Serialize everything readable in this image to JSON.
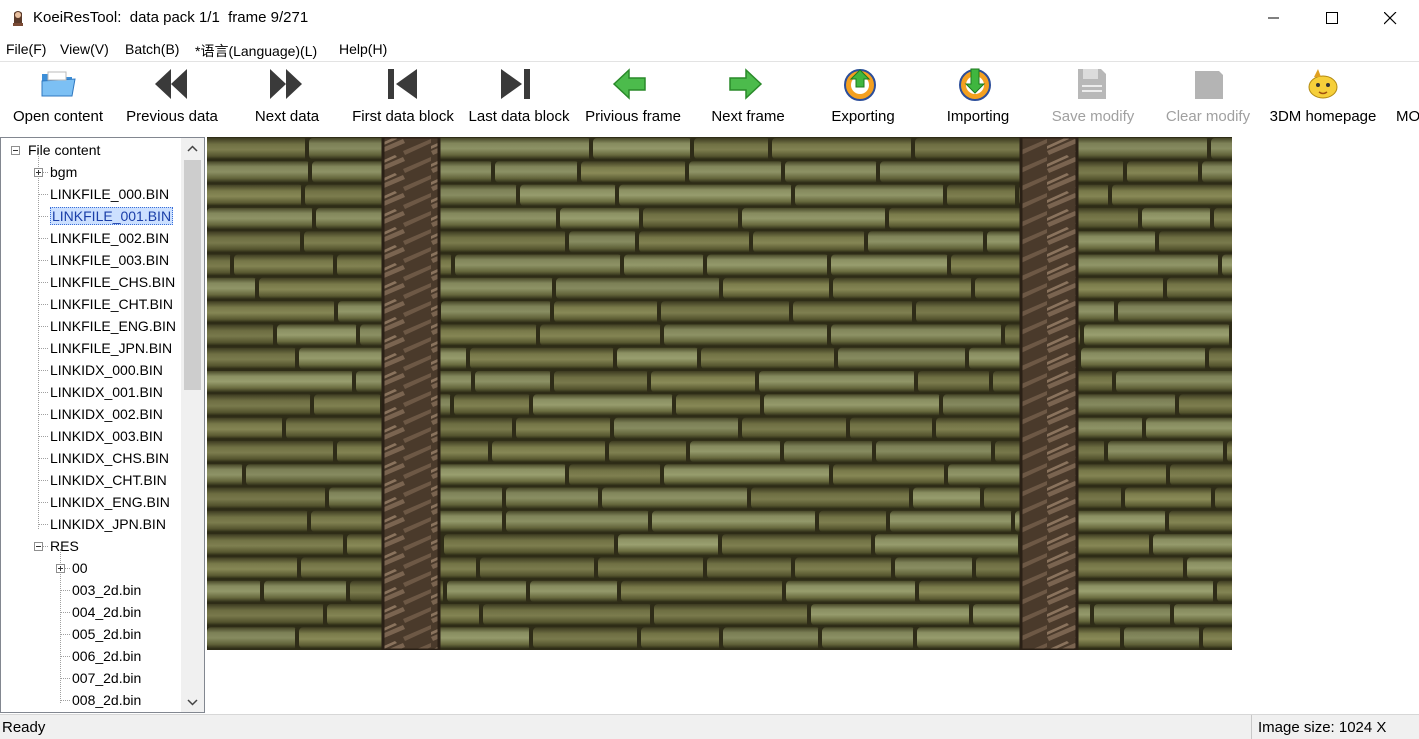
{
  "window": {
    "app_name": "KoeiResTool:",
    "title_info": "data pack 1/1  frame 9/271"
  },
  "menu": [
    "File(F)",
    "View(V)",
    "Batch(B)",
    "*语言(Language)(L)",
    "Help(H)"
  ],
  "toolbar": [
    {
      "label": "Open content",
      "icon": "open-folder-icon",
      "enabled": true
    },
    {
      "label": "Previous data",
      "icon": "double-left-arrow-icon",
      "enabled": true
    },
    {
      "label": "Next data",
      "icon": "double-right-arrow-icon",
      "enabled": true
    },
    {
      "label": "First data block",
      "icon": "skip-first-icon",
      "enabled": true
    },
    {
      "label": "Last data block",
      "icon": "skip-last-icon",
      "enabled": true
    },
    {
      "label": "Privious frame",
      "icon": "green-left-arrow-icon",
      "enabled": true
    },
    {
      "label": "Next frame",
      "icon": "green-right-arrow-icon",
      "enabled": true
    },
    {
      "label": "Exporting",
      "icon": "export-icon",
      "enabled": true
    },
    {
      "label": "Importing",
      "icon": "import-icon",
      "enabled": true
    },
    {
      "label": "Save modify",
      "icon": "save-icon",
      "enabled": false
    },
    {
      "label": "Clear modify",
      "icon": "clear-icon",
      "enabled": false
    },
    {
      "label": "3DM homepage",
      "icon": "homepage-mascot-icon",
      "enabled": true
    },
    {
      "label": "MO",
      "icon": "",
      "enabled": true
    }
  ],
  "tree": {
    "root": "File content",
    "items": [
      {
        "label": "bgm",
        "level": 1,
        "expander": "plus"
      },
      {
        "label": "LINKFILE_000.BIN",
        "level": 1
      },
      {
        "label": "LINKFILE_001.BIN",
        "level": 1,
        "selected": true
      },
      {
        "label": "LINKFILE_002.BIN",
        "level": 1
      },
      {
        "label": "LINKFILE_003.BIN",
        "level": 1
      },
      {
        "label": "LINKFILE_CHS.BIN",
        "level": 1
      },
      {
        "label": "LINKFILE_CHT.BIN",
        "level": 1
      },
      {
        "label": "LINKFILE_ENG.BIN",
        "level": 1
      },
      {
        "label": "LINKFILE_JPN.BIN",
        "level": 1
      },
      {
        "label": "LINKIDX_000.BIN",
        "level": 1
      },
      {
        "label": "LINKIDX_001.BIN",
        "level": 1
      },
      {
        "label": "LINKIDX_002.BIN",
        "level": 1
      },
      {
        "label": "LINKIDX_003.BIN",
        "level": 1
      },
      {
        "label": "LINKIDX_CHS.BIN",
        "level": 1
      },
      {
        "label": "LINKIDX_CHT.BIN",
        "level": 1
      },
      {
        "label": "LINKIDX_ENG.BIN",
        "level": 1
      },
      {
        "label": "LINKIDX_JPN.BIN",
        "level": 1
      },
      {
        "label": "RES",
        "level": 1,
        "expander": "minus"
      },
      {
        "label": "00",
        "level": 2,
        "expander": "plus"
      },
      {
        "label": "003_2d.bin",
        "level": 2
      },
      {
        "label": "004_2d.bin",
        "level": 2
      },
      {
        "label": "005_2d.bin",
        "level": 2
      },
      {
        "label": "006_2d.bin",
        "level": 2
      },
      {
        "label": "007_2d.bin",
        "level": 2
      },
      {
        "label": "008_2d.bin",
        "level": 2
      }
    ]
  },
  "status": {
    "left": "Ready",
    "image_size": "Image size:  1024 X"
  },
  "colors": {
    "selection_bg": "#cce0ff",
    "bamboo_light": "#8c9160",
    "bamboo_dark": "#3f3d22",
    "rope": "#5a4532",
    "status_bg": "#f0f0f0"
  }
}
